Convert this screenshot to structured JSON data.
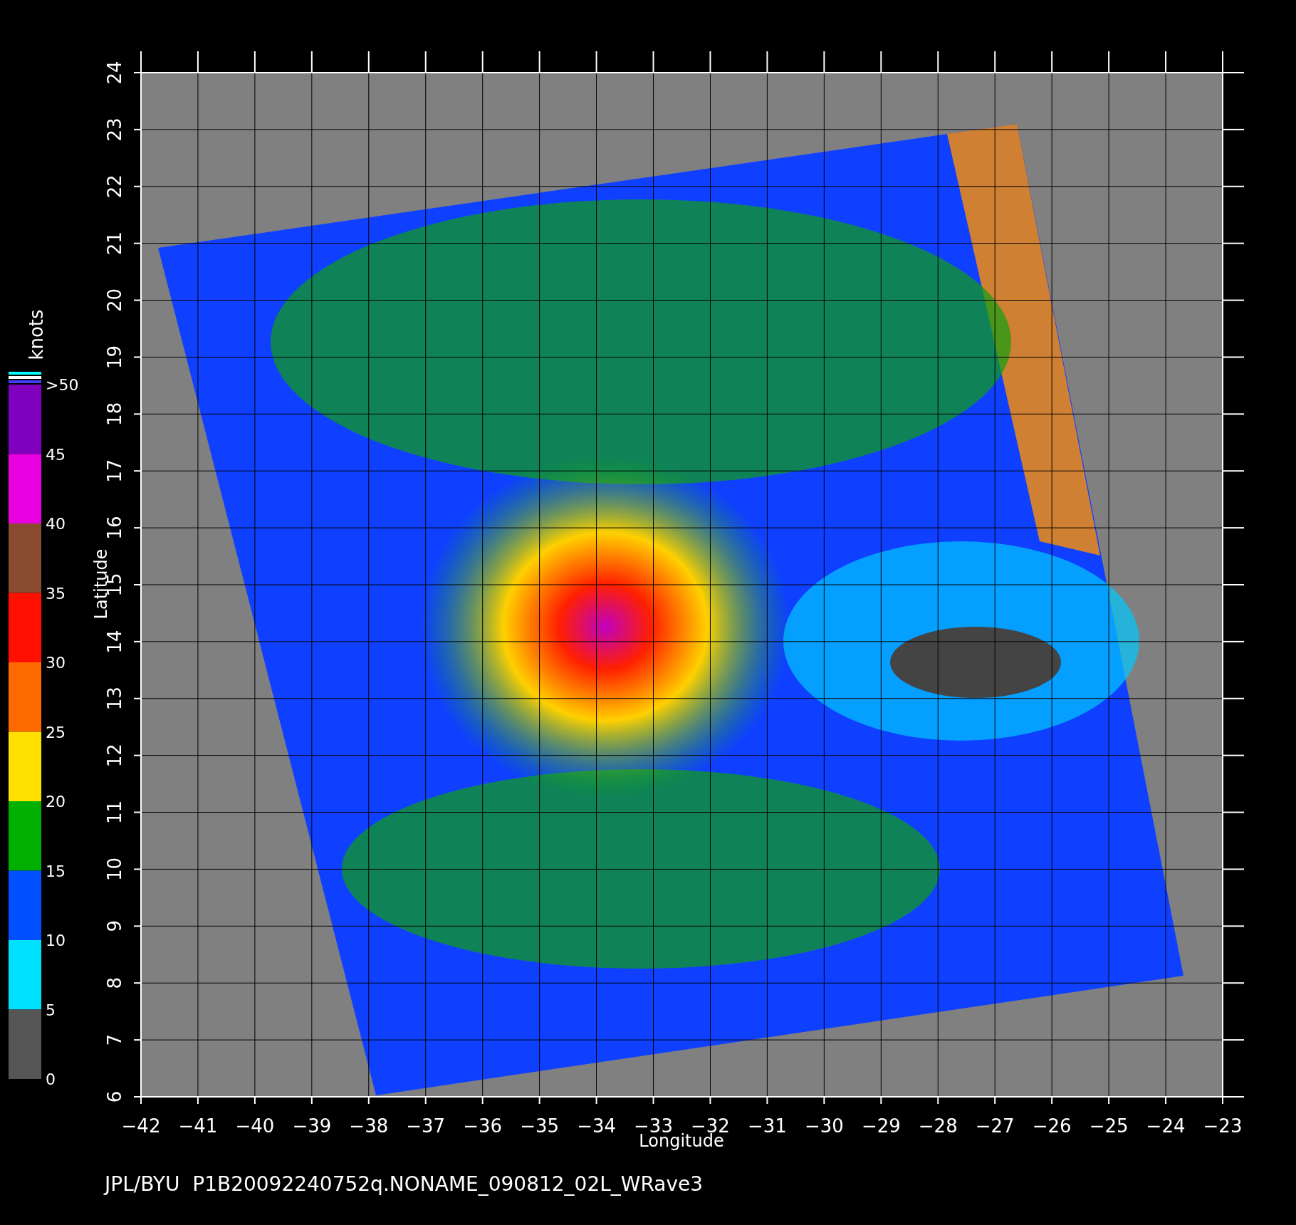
{
  "plot": {
    "xlabel": "Longitude",
    "ylabel": "Latitude",
    "xticks": [
      "−42",
      "−41",
      "−40",
      "−39",
      "−38",
      "−37",
      "−36",
      "−35",
      "−34",
      "−33",
      "−32",
      "−31",
      "−30",
      "−29",
      "−28",
      "−27",
      "−26",
      "−25",
      "−24",
      "−23"
    ],
    "yticks": [
      "6",
      "7",
      "8",
      "9",
      "10",
      "11",
      "12",
      "13",
      "14",
      "15",
      "16",
      "17",
      "18",
      "19",
      "20",
      "21",
      "22",
      "23",
      "24"
    ]
  },
  "colorbar": {
    "unit": "knots",
    "segments": [
      {
        "color": "#8000c0"
      },
      {
        "color": "#e800e0"
      },
      {
        "color": "#8a4a30"
      },
      {
        "color": "#ff1000"
      },
      {
        "color": "#ff6a00"
      },
      {
        "color": "#ffe000"
      },
      {
        "color": "#00b000"
      },
      {
        "color": "#0050ff"
      },
      {
        "color": "#00e0ff"
      },
      {
        "color": "#555555"
      }
    ],
    "labels": [
      ">50",
      "45",
      "40",
      "35",
      "30",
      "25",
      "20",
      "15",
      "10",
      "5",
      "0"
    ]
  },
  "footer": "JPL/BYU  P1B20092240752q.NONAME_090812_02L_WRave3"
}
